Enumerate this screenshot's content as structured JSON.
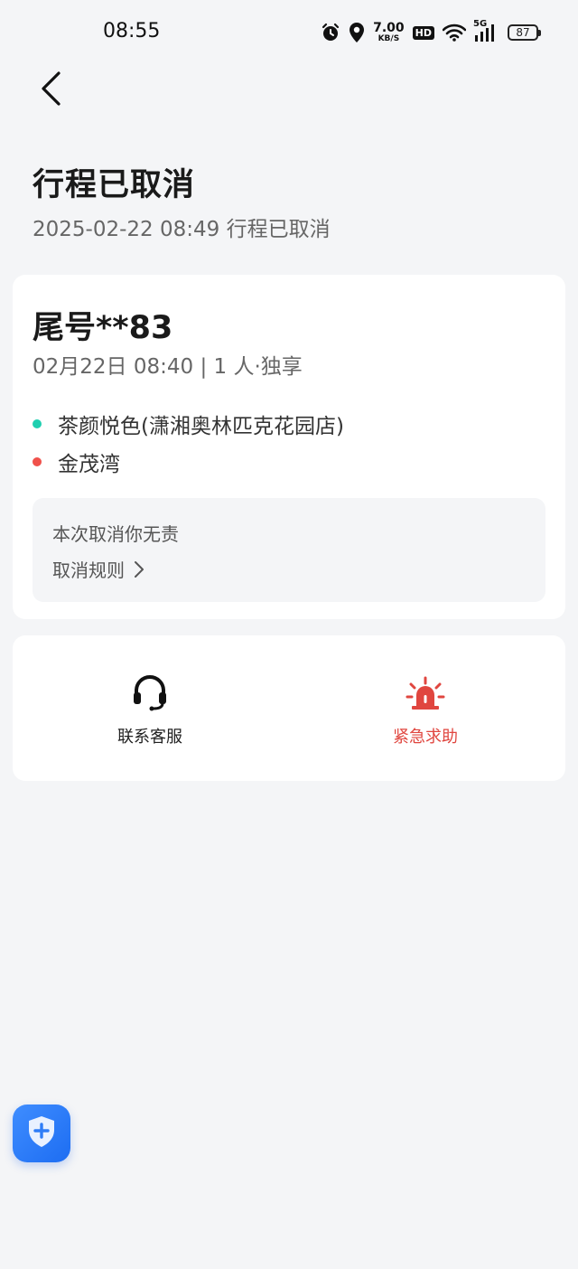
{
  "status_bar": {
    "time": "08:55",
    "net_speed_value": "7.00",
    "net_speed_unit": "KB/S",
    "hd_label": "HD",
    "network_label": "5G",
    "battery_level": "87",
    "icons": [
      "alarm-icon",
      "location-icon",
      "wifi-icon",
      "signal-icon",
      "battery-icon"
    ]
  },
  "header": {
    "back_icon": "chevron-left-icon",
    "title": "行程已取消",
    "subtitle": "2025-02-22 08:49 行程已取消"
  },
  "trip": {
    "plate": "尾号**83",
    "meta": "02月22日 08:40 | 1 人·独享",
    "start": "茶颜悦色(潇湘奥林匹克花园店)",
    "end": "金茂湾",
    "start_dot_color": "#1fcfb0",
    "end_dot_color": "#f0514b",
    "notice": "本次取消你无责",
    "rules_link": "取消规则"
  },
  "actions": {
    "service_label": "联系客服",
    "service_icon": "headset-icon",
    "sos_label": "紧急求助",
    "sos_icon": "siren-icon",
    "sos_color": "#e0463f"
  },
  "safety": {
    "icon": "shield-plus-icon",
    "color": "#2f7df7"
  }
}
